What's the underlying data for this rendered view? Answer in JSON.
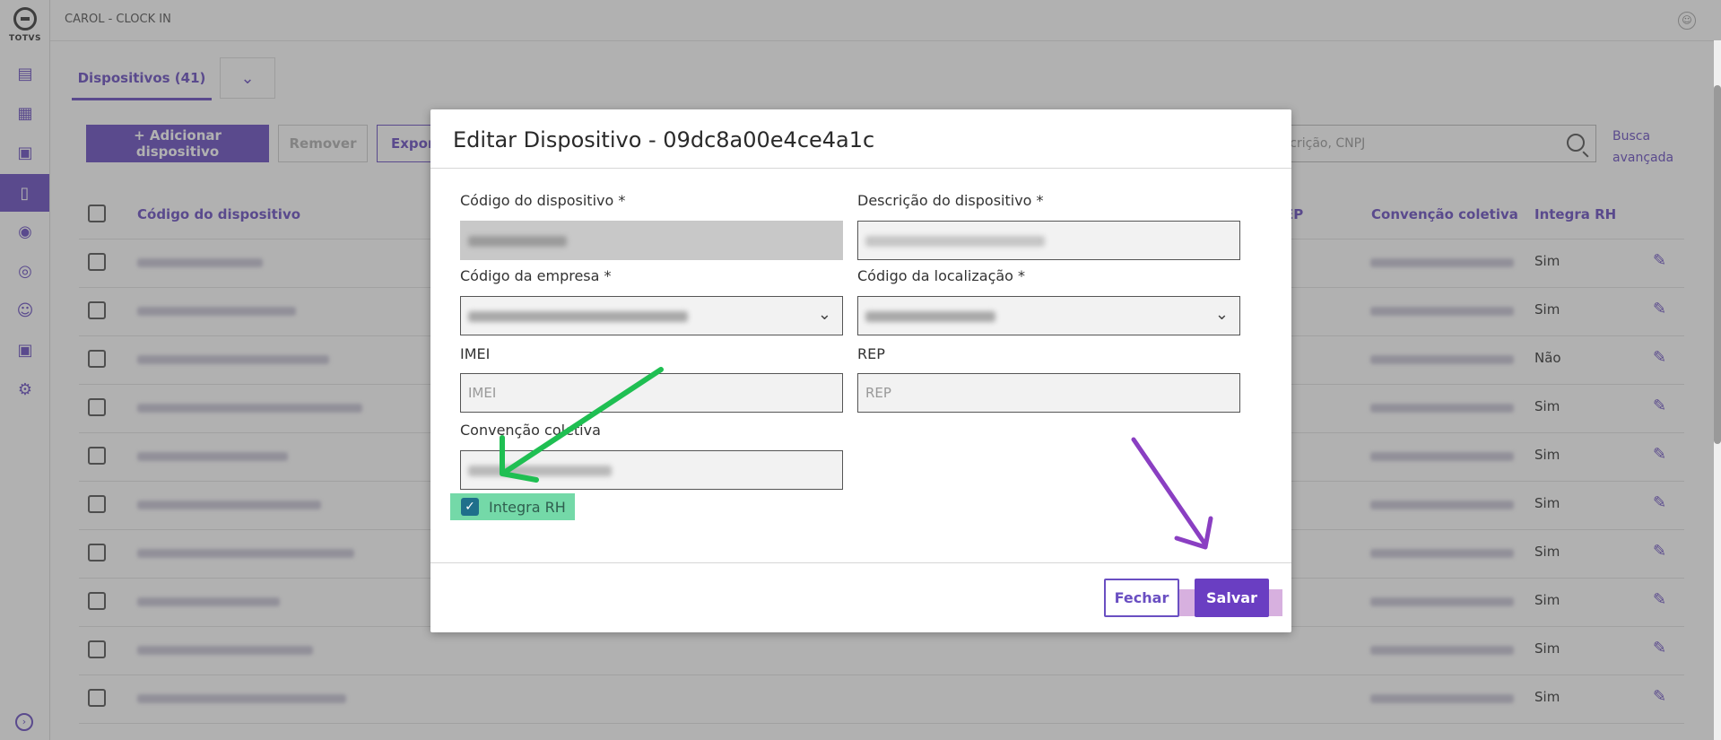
{
  "app": {
    "title": "CAROL - CLOCK IN",
    "brand": "TOTVS"
  },
  "sidebar": {
    "icons": [
      "chart-icon",
      "building-icon",
      "map-icon",
      "device-icon",
      "signal-icon",
      "location-icon",
      "users-icon",
      "lock-icon",
      "gear-icon"
    ],
    "active": "device-icon",
    "expand_icon": "expand-icon"
  },
  "tabs": {
    "active_label": "Dispositivos (41)"
  },
  "toolbar": {
    "add_label": "+ Adicionar dispositivo",
    "remove_label": "Remover",
    "export_label": "Expor",
    "search_placeholder": "scrição, CNPJ",
    "advanced_search": "Busca avançada"
  },
  "table": {
    "headers": [
      "Código do dispositivo",
      "EP",
      "Convenção coletiva",
      "Integra RH"
    ],
    "integra_values": [
      "Sim",
      "Sim",
      "Não",
      "Sim",
      "Sim",
      "Sim",
      "Sim",
      "Sim",
      "Sim",
      "Sim"
    ]
  },
  "modal": {
    "title": "Editar Dispositivo - 09dc8a00e4ce4a1c",
    "fields": {
      "device_code_label": "Código do dispositivo *",
      "device_desc_label": "Descrição do dispositivo *",
      "company_code_label": "Código da empresa *",
      "location_code_label": "Código da localização *",
      "imei_label": "IMEI",
      "imei_placeholder": "IMEI",
      "rep_label": "REP",
      "rep_placeholder": "REP",
      "convention_label": "Convenção coletiva"
    },
    "checkbox": {
      "label": "Integra RH",
      "checked": true
    },
    "close_label": "Fechar",
    "save_label": "Salvar"
  },
  "colors": {
    "accent": "#6a4fc2",
    "save": "#6a3ec2",
    "highlight_green": "#74d9a8",
    "arrow_green": "#1fbf52",
    "arrow_purple": "#8a3fc2"
  }
}
